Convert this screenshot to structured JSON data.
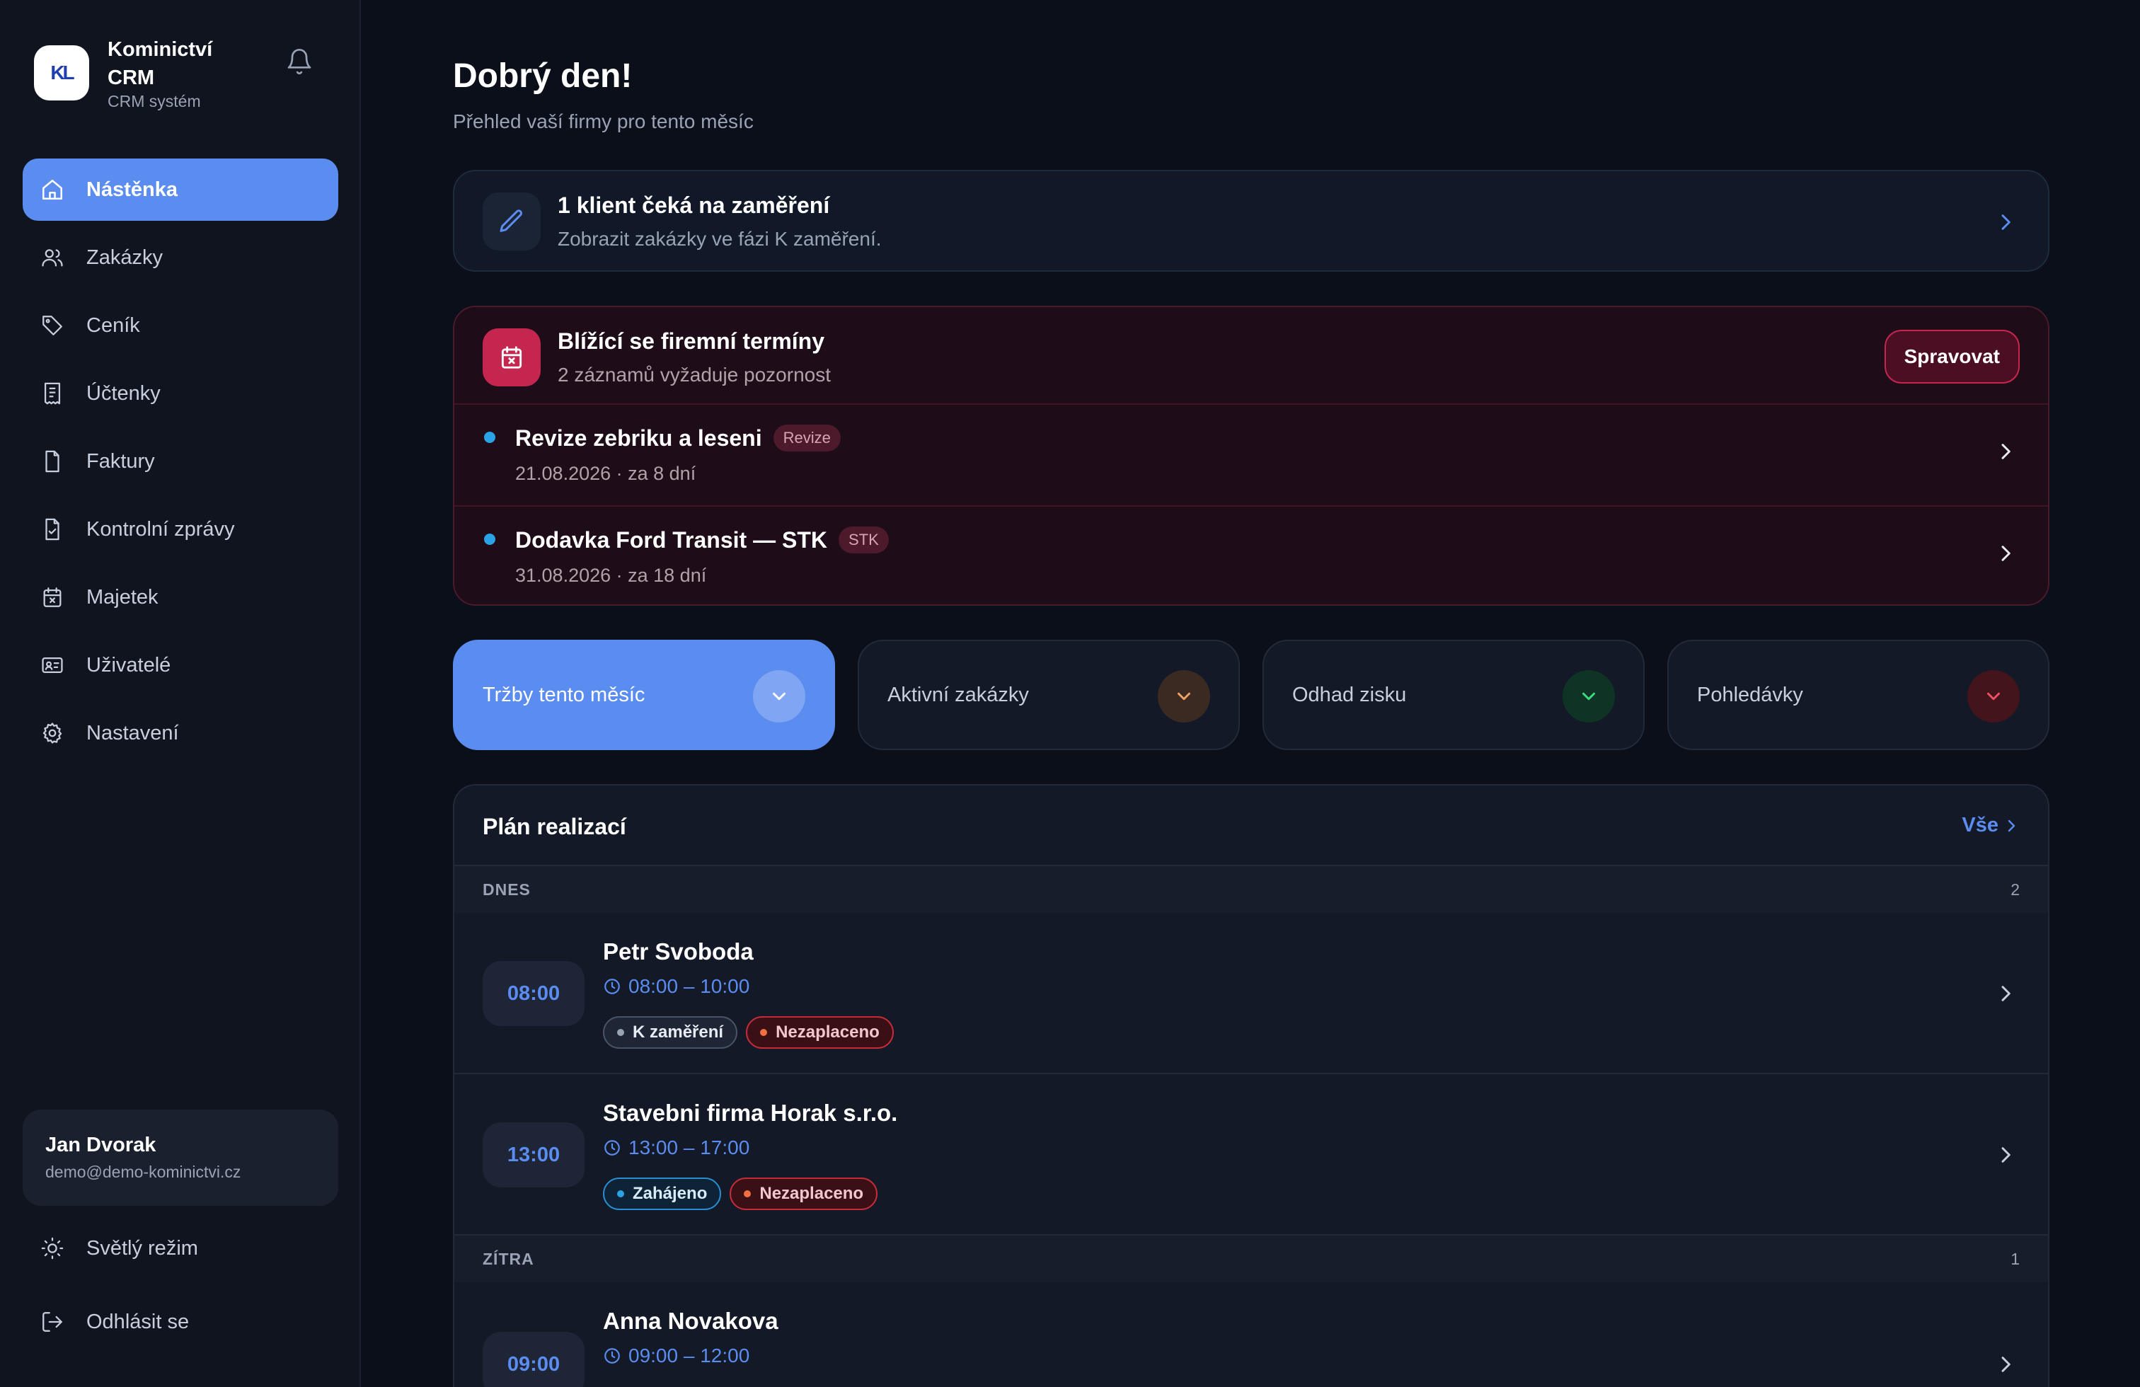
{
  "brand": {
    "name": "Kominictví CRM",
    "subtitle": "CRM systém",
    "logo": "KL"
  },
  "sidebar": {
    "items": [
      {
        "label": "Nástěnka",
        "icon": "home-icon",
        "active": true
      },
      {
        "label": "Zakázky",
        "icon": "users-icon"
      },
      {
        "label": "Ceník",
        "icon": "tag-icon"
      },
      {
        "label": "Účtenky",
        "icon": "receipt-icon"
      },
      {
        "label": "Faktury",
        "icon": "file-icon"
      },
      {
        "label": "Kontrolní zprávy",
        "icon": "file-check-icon"
      },
      {
        "label": "Majetek",
        "icon": "calendar-x-icon"
      },
      {
        "label": "Uživatelé",
        "icon": "id-card-icon"
      },
      {
        "label": "Nastavení",
        "icon": "gear-icon"
      }
    ],
    "user": {
      "name": "Jan Dvorak",
      "email": "demo@demo-kominictvi.cz"
    },
    "theme_label": "Světlý režim",
    "logout_label": "Odhlásit se"
  },
  "header": {
    "title": "Dobrý den!",
    "subtitle": "Přehled vaší firmy pro tento měsíc"
  },
  "alert": {
    "title": "1 klient čeká na zaměření",
    "subtitle": "Zobrazit zakázky ve fázi K zaměření."
  },
  "terms": {
    "title": "Blížící se firemní termíny",
    "subtitle": "2 záznamů vyžaduje pozornost",
    "manage_label": "Spravovat",
    "items": [
      {
        "name": "Revize zebriku a leseni",
        "badge": "Revize",
        "date": "21.08.2026 · za 8 dní"
      },
      {
        "name": "Dodavka Ford Transit — STK",
        "badge": "STK",
        "date": "31.08.2026 · za 18 dní"
      }
    ]
  },
  "kpis": [
    {
      "label": "Tržby tento měsíc",
      "color": "#5b8cf0"
    },
    {
      "label": "Aktivní zakázky",
      "color": "#f0a060"
    },
    {
      "label": "Odhad zisku",
      "color": "#3ddc84"
    },
    {
      "label": "Pohledávky",
      "color": "#f05060"
    }
  ],
  "plan": {
    "title": "Plán realizací",
    "all_label": "Vše",
    "days": [
      {
        "label": "DNES",
        "count": "2",
        "appointments": [
          {
            "time": "08:00",
            "name": "Petr Svoboda",
            "range": "08:00 – 10:00",
            "tags": [
              "K zaměření",
              "Nezaplaceno"
            ]
          },
          {
            "time": "13:00",
            "name": "Stavebni firma Horak s.r.o.",
            "range": "13:00 – 17:00",
            "tags": [
              "Zahájeno",
              "Nezaplaceno"
            ]
          }
        ]
      },
      {
        "label": "ZÍTRA",
        "count": "1",
        "appointments": [
          {
            "time": "09:00",
            "name": "Anna Novakova",
            "range": "09:00 – 12:00",
            "tags": []
          }
        ]
      }
    ]
  }
}
